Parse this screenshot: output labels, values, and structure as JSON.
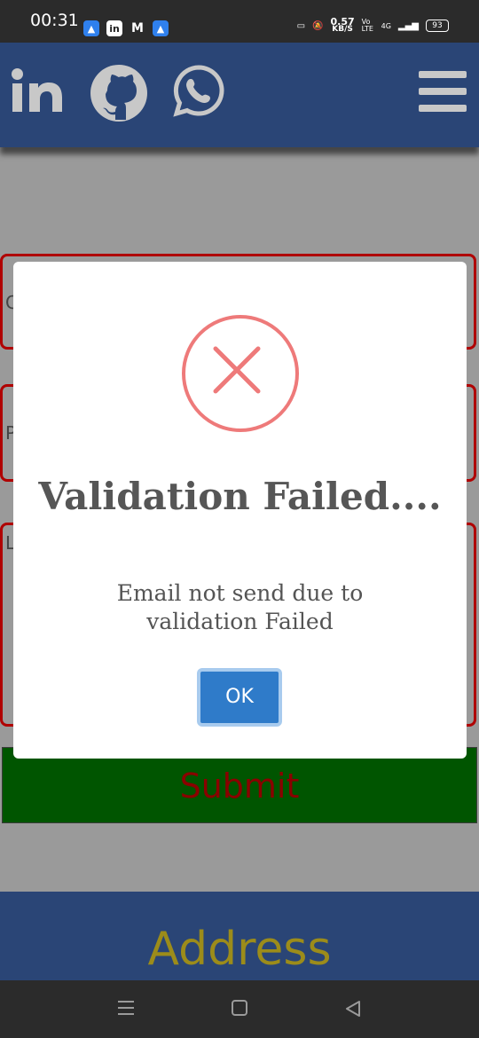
{
  "status_bar": {
    "time": "00:31",
    "speed_value": "0.57",
    "speed_unit": "KB/S",
    "network_label": "Vo LTE",
    "signal_label": "4G",
    "battery": "93"
  },
  "header": {
    "icons": [
      "linkedin-icon",
      "github-icon",
      "whatsapp-icon",
      "menu-icon"
    ],
    "background": "#2a4576"
  },
  "form": {
    "field_letters": [
      "C",
      "P",
      "L"
    ],
    "submit_label": "Submit"
  },
  "footer": {
    "address_title": "Address"
  },
  "modal": {
    "title": "Validation Failed....",
    "message": "Email not send due to validation Failed",
    "ok_label": "OK",
    "icon": "error-x-icon",
    "accent": "#ee7a7a"
  },
  "colors": {
    "header": "#2a4576",
    "field_border": "#b00000",
    "submit_bg": "#005500",
    "address_text": "#9c8c1a"
  }
}
